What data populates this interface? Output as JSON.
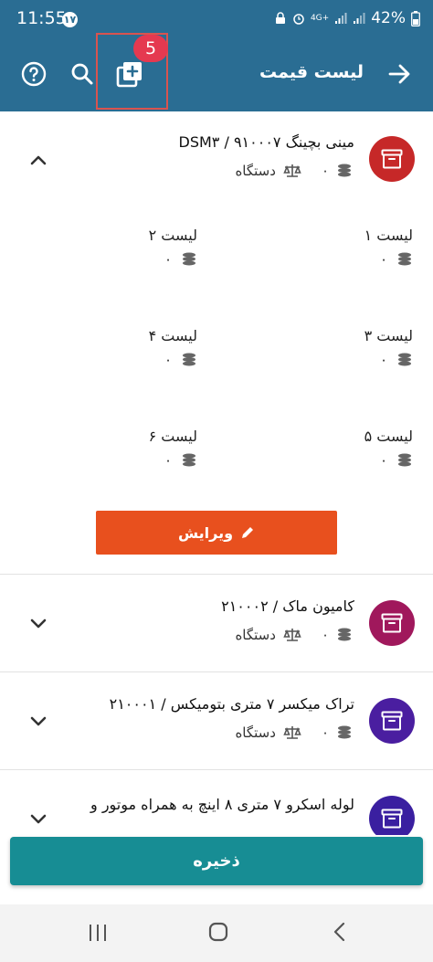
{
  "status_bar": {
    "time": "11:55",
    "notification_badge": "۱۷",
    "network": "4G+",
    "battery": "42%"
  },
  "app_bar": {
    "title": "لیست قیمت",
    "add_badge_count": "5"
  },
  "items": [
    {
      "title": "مینی بچینگ DSM۳ / ۹۱۰۰۰۷",
      "stock": "۰",
      "unit": "دستگاه",
      "avatar_color": "#c62828",
      "expanded": true,
      "prices": [
        {
          "label": "لیست ۱",
          "value": "۰"
        },
        {
          "label": "لیست ۲",
          "value": "۰"
        },
        {
          "label": "لیست ۳",
          "value": "۰"
        },
        {
          "label": "لیست ۴",
          "value": "۰"
        },
        {
          "label": "لیست ۵",
          "value": "۰"
        },
        {
          "label": "لیست ۶",
          "value": "۰"
        }
      ],
      "edit_label": "ویرایش"
    },
    {
      "title": "کامیون ماک / ۲۱۰۰۰۲",
      "stock": "۰",
      "unit": "دستگاه",
      "avatar_color": "#a0185c",
      "expanded": false
    },
    {
      "title": "تراک میکسر ۷ متری بتومیکس / ۲۱۰۰۰۱",
      "stock": "۰",
      "unit": "دستگاه",
      "avatar_color": "#4a1ea0",
      "expanded": false
    },
    {
      "title": "لوله اسکرو ۷ متری ۸ اینچ به همراه موتور و",
      "avatar_color": "#3a1fa0",
      "expanded": false
    }
  ],
  "save_label": "ذخیره",
  "colors": {
    "primary": "#2a6d93",
    "accent": "#e8501e",
    "save": "#178d94",
    "badge": "#e53950"
  },
  "icons": [
    "help-icon",
    "search-icon",
    "add-collection-icon",
    "back-arrow-icon",
    "archive-icon",
    "coins-icon",
    "scale-icon",
    "chevron-up-icon",
    "chevron-down-icon",
    "pencil-icon",
    "recent-apps-icon",
    "home-icon",
    "nav-back-icon"
  ]
}
